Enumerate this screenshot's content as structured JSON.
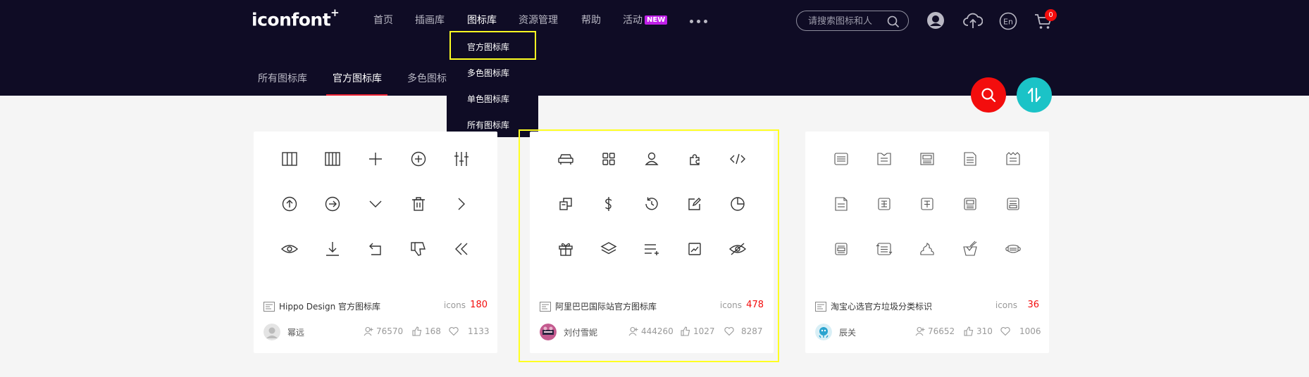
{
  "header": {
    "logo": "iconfont",
    "logo_plus": "+",
    "nav": [
      {
        "label": "首页"
      },
      {
        "label": "插画库"
      },
      {
        "label": "图标库",
        "active": true
      },
      {
        "label": "资源管理"
      },
      {
        "label": "帮助"
      },
      {
        "label": "活动",
        "badge": "NEW"
      }
    ],
    "search_placeholder": "请搜索图标和人",
    "cart_count": "0",
    "lang": "En",
    "icons": [
      "more-dots-icon",
      "search-icon",
      "user-avatar-icon",
      "upload-cloud-icon",
      "language-en-icon",
      "cart-icon"
    ]
  },
  "subnav": {
    "items": [
      {
        "label": "所有图标库"
      },
      {
        "label": "官方图标库",
        "active": true
      },
      {
        "label": "多色图标"
      }
    ]
  },
  "dropdown": {
    "items": [
      {
        "label": "官方图标库",
        "highlighted": true
      },
      {
        "label": "多色图标库"
      },
      {
        "label": "单色图标库"
      },
      {
        "label": "所有图标库"
      }
    ]
  },
  "fabs": {
    "search": "search-icon",
    "sort": "sort-toggle-icon"
  },
  "colors": {
    "header_bg": "#0f0c25",
    "accent_red": "#f30d0d",
    "teal": "#1bc3c7",
    "highlight": "#ffff22",
    "badge_purple": "#c020e8"
  },
  "cards": [
    {
      "title": "Hippo Design 官方图标库",
      "icons_label": "icons",
      "icons_count": "180",
      "author": "幂远",
      "stats": {
        "followers": "76570",
        "likes": "168",
        "favorites": "1133"
      },
      "icons": [
        "columns-icon",
        "grid-columns-icon",
        "plus-icon",
        "plus-circle-icon",
        "sliders-icon",
        "arrow-up-circle-icon",
        "arrow-right-circle-icon",
        "chevron-down-icon",
        "trash-icon",
        "chevron-right-icon",
        "eye-icon",
        "download-icon",
        "undo-icon",
        "thumbs-down-icon",
        "double-chevron-left-icon"
      ]
    },
    {
      "title": "阿里巴巴国际站官方图标库",
      "icons_label": "icons",
      "icons_count": "478",
      "author": "刘付雪妮",
      "stats": {
        "followers": "444260",
        "likes": "1027",
        "favorites": "8287"
      },
      "icons": [
        "car-icon",
        "apps-icon",
        "user-icon",
        "puzzle-icon",
        "code-icon",
        "copy-icon",
        "dollar-icon",
        "history-icon",
        "edit-icon",
        "pie-chart-icon",
        "gift-icon",
        "layers-icon",
        "list-add-icon",
        "trend-icon",
        "eye-off-icon"
      ]
    },
    {
      "title": "淘宝心选官方垃圾分类标识",
      "icons_label": "icons",
      "icons_count": "36",
      "author": "辰关",
      "stats": {
        "followers": "76652",
        "likes": "310",
        "favorites": "1006"
      },
      "icons": [
        "waste-label-icon",
        "shirt-label-icon",
        "box-label-icon",
        "doc-label-icon",
        "bag-label-icon",
        "paper-label-icon",
        "bottle-label-icon",
        "pot-label-icon",
        "food-label-icon",
        "other-label-icon",
        "hazard-label-icon",
        "recycle-label-icon",
        "poop-icon",
        "takeout-box-icon",
        "mask-icon"
      ]
    }
  ]
}
